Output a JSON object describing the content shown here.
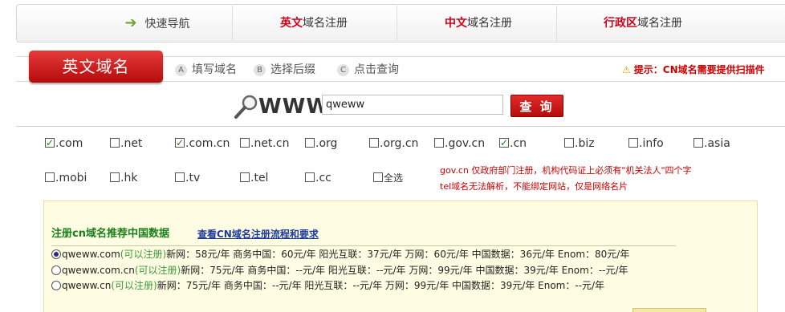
{
  "top_nav": {
    "quick_nav": "快速导航",
    "tabs": [
      {
        "highlight": "英文",
        "rest": "域名注册"
      },
      {
        "highlight": "中文",
        "rest": "域名注册"
      },
      {
        "highlight": "行政区",
        "rest": "域名注册"
      }
    ]
  },
  "steps": {
    "active_tab": "英文域名",
    "items": [
      {
        "letter": "A",
        "label": "填写域名"
      },
      {
        "letter": "B",
        "label": "选择后缀"
      },
      {
        "letter": "C",
        "label": "点击查询"
      }
    ],
    "tip": "提示：CN域名需要提供扫描件"
  },
  "search": {
    "prefix": "WWW",
    "value": "qweww",
    "button": "查 询"
  },
  "extensions": {
    "row1": [
      {
        "label": ".com",
        "checked": true
      },
      {
        "label": ".net",
        "checked": false
      },
      {
        "label": ".com.cn",
        "checked": true
      },
      {
        "label": ".net.cn",
        "checked": false
      },
      {
        "label": ".org",
        "checked": false
      },
      {
        "label": ".org.cn",
        "checked": false
      },
      {
        "label": ".gov.cn",
        "checked": false
      },
      {
        "label": ".cn",
        "checked": true
      },
      {
        "label": ".biz",
        "checked": false
      },
      {
        "label": ".info",
        "checked": false
      },
      {
        "label": ".asia",
        "checked": false
      }
    ],
    "row2": [
      {
        "label": ".mobi",
        "checked": false
      },
      {
        "label": ".hk",
        "checked": false
      },
      {
        "label": ".tv",
        "checked": false
      },
      {
        "label": ".tel",
        "checked": false
      },
      {
        "label": ".cc",
        "checked": false
      },
      {
        "label": "全选",
        "checked": false
      }
    ],
    "notice_line1": "gov.cn 仅政府部门注册，机构代码证上必须有\"机关法人\"四个字",
    "notice_line2": "tel域名无法解析，不能绑定网站，仅是网络名片"
  },
  "recommend": {
    "title": "注册cn域名推荐中国数据",
    "link": "查看CN域名注册流程和要求",
    "rows": [
      {
        "domain": "qweww.com",
        "status": "(可以注册)",
        "prices": "新网：58元/年  商务中国：60元/年  阳光互联：37元/年  万网：60元/年  中国数据：36元/年  Enom：80元/年",
        "selected": true
      },
      {
        "domain": "qweww.com.cn",
        "status": "(可以注册)",
        "prices": "新网：75元/年  商务中国：--元/年  阳光互联：--元/年  万网：99元/年  中国数据：39元/年  Enom：--元/年",
        "selected": false
      },
      {
        "domain": "qweww.cn",
        "status": "(可以注册)",
        "prices": "新网：75元/年  商务中国：--元/年  阳光互联：--元/年  万网：99元/年  中国数据：39元/年  Enom：--元/年",
        "selected": false
      }
    ]
  },
  "colors": {
    "accent_red": "#d0021b",
    "available_green": "#3a9a3a",
    "panel_bg": "#fefde3"
  }
}
